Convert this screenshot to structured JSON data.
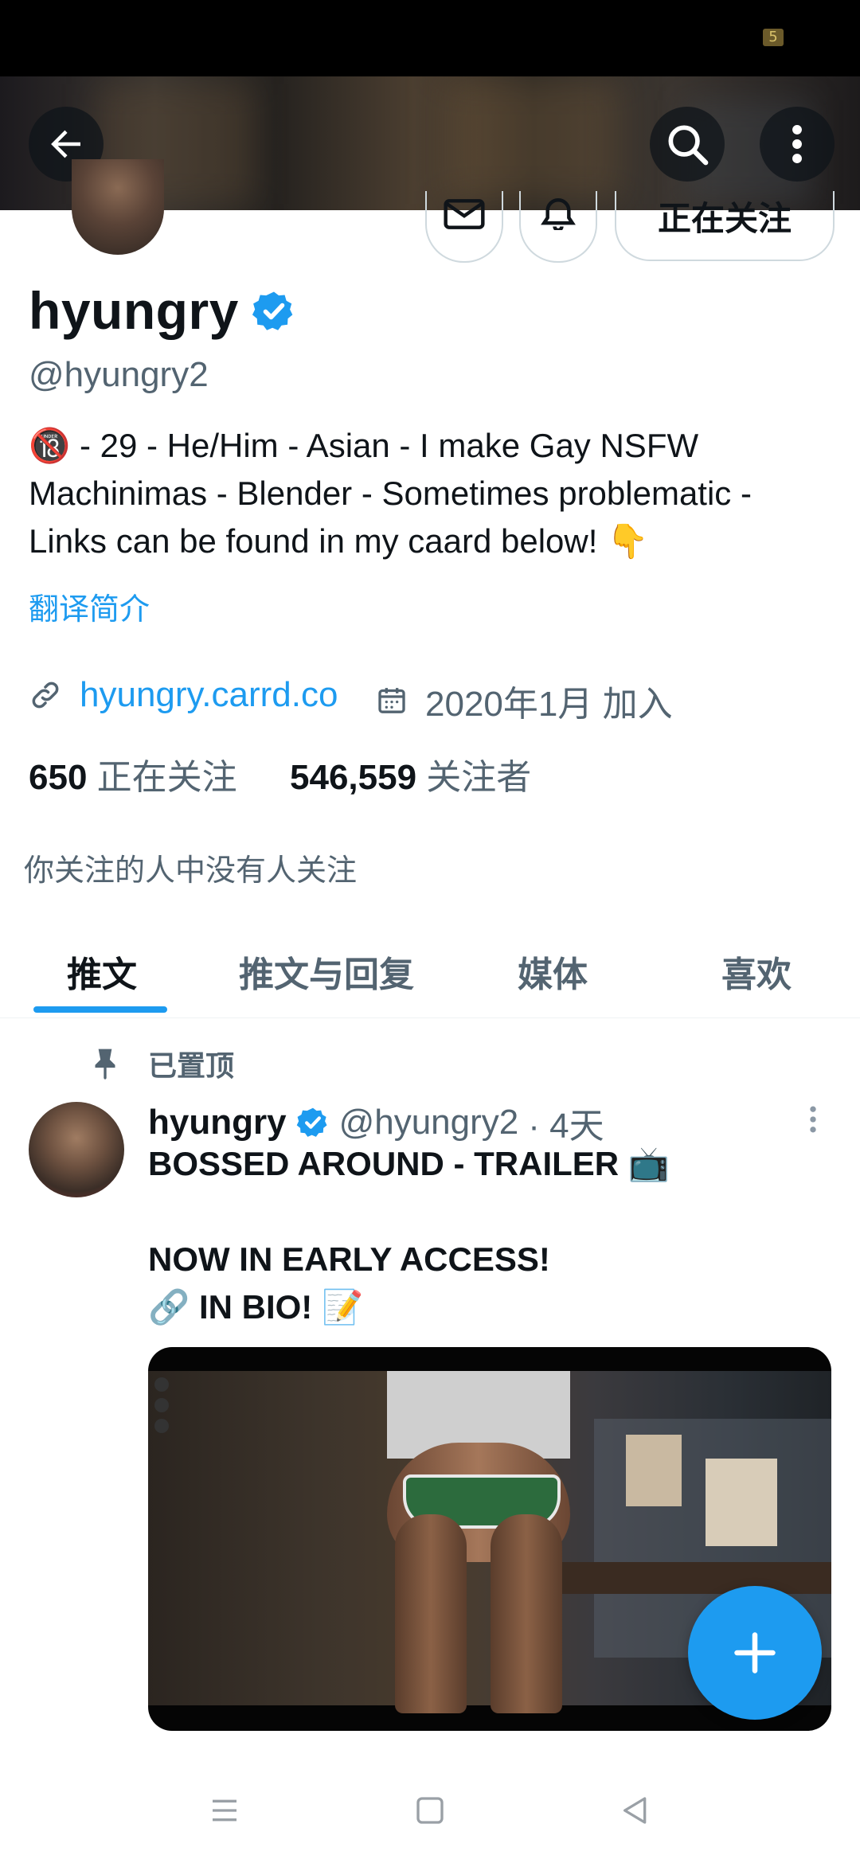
{
  "status_bar": {
    "battery_badge": "5"
  },
  "profile": {
    "name": "hyungry",
    "handle": "@hyungry2",
    "follow_button_label": "正在关注",
    "bio": {
      "part1": " - 29 - He/Him - Asian - I make Gay NSFW Machinimas - Blender - Sometimes problematic - Links can be found in my caard below! ",
      "emoji_start": "🔞",
      "emoji_end": "👇"
    },
    "translate_label": "翻译简介",
    "website": "hyungry.carrd.co",
    "joined": "2020年1月 加入",
    "following_count": "650",
    "following_label": "正在关注",
    "followers_count": "546,559",
    "followers_label": "关注者",
    "mutual_text": "你关注的人中没有人关注"
  },
  "tabs": [
    {
      "label": "推文",
      "active": true
    },
    {
      "label": "推文与回复",
      "active": false
    },
    {
      "label": "媒体",
      "active": false
    },
    {
      "label": "喜欢",
      "active": false
    }
  ],
  "pinned_post": {
    "pinned_label": "已置顶",
    "author_name": "hyungry",
    "author_handle": "@hyungry2",
    "time": "· 4天",
    "lines": [
      "BOSSED AROUND - TRAILER 📺",
      "",
      "NOW IN EARLY ACCESS!",
      "🔗 IN BIO! 📝"
    ]
  },
  "colors": {
    "accent": "#1d9bf0",
    "text_primary": "#0f1419",
    "text_secondary": "#536471"
  },
  "icons": [
    "back-arrow-icon",
    "search-icon",
    "more-vertical-icon",
    "mail-icon",
    "bell-plus-icon",
    "verified-badge-icon",
    "link-icon",
    "calendar-icon",
    "pin-icon",
    "compose-plus-icon",
    "menu-icon",
    "home-square-icon",
    "back-triangle-icon"
  ]
}
